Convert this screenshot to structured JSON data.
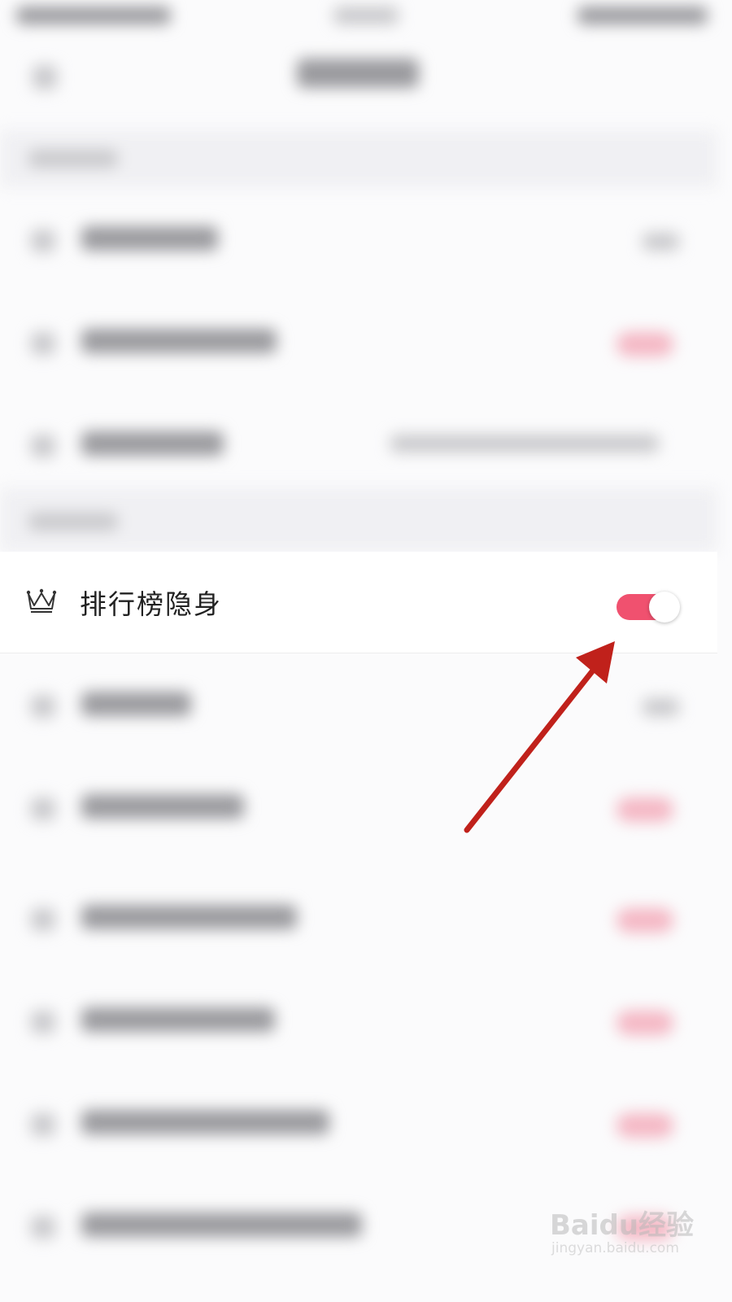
{
  "setting_row": {
    "label": "排行榜隐身",
    "icon": "crown-icon",
    "toggle_on": true,
    "toggle_color": "#f0516f"
  },
  "annotation": {
    "icon": "arrow-icon",
    "color": "#c0211b"
  },
  "watermark": {
    "brand": "Baidu经验",
    "url": "jingyan.baidu.com"
  }
}
